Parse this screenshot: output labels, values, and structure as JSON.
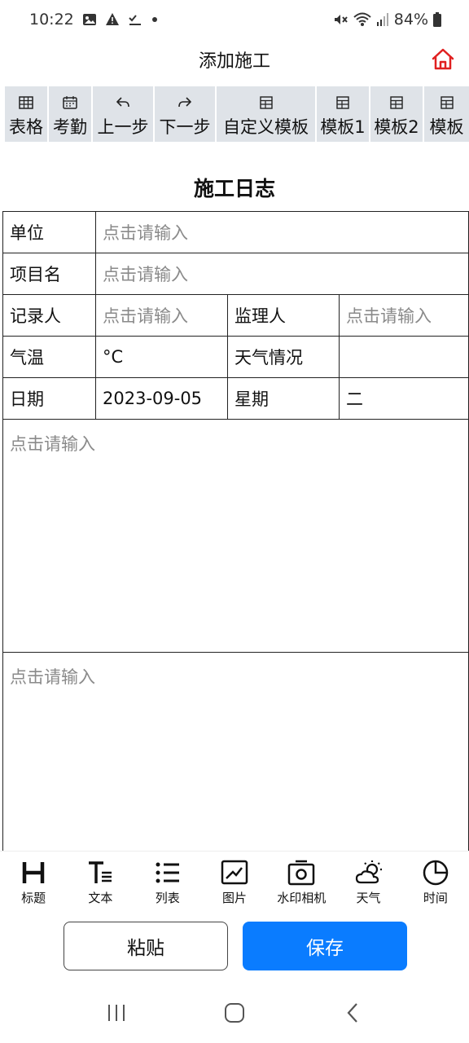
{
  "status_bar": {
    "time": "10:22",
    "battery": "84%",
    "left_icons": [
      "image-icon",
      "warning-icon",
      "checklist-icon",
      "dot-icon"
    ],
    "right_icons": [
      "mute-icon",
      "wifi-icon",
      "signal-icon",
      "battery-icon"
    ]
  },
  "header": {
    "title": "添加施工",
    "home_icon": "home-icon",
    "accent": "#e02020"
  },
  "toolbar": {
    "items": [
      {
        "label": "表格",
        "icon": "table-icon"
      },
      {
        "label": "考勤",
        "icon": "calendar-icon"
      },
      {
        "label": "上一步",
        "icon": "undo-icon"
      },
      {
        "label": "下一步",
        "icon": "redo-icon"
      },
      {
        "label": "自定义模板",
        "icon": "template-icon"
      },
      {
        "label": "模板1",
        "icon": "template-icon"
      },
      {
        "label": "模板2",
        "icon": "template-icon"
      },
      {
        "label": "模板",
        "icon": "template-icon"
      }
    ]
  },
  "document": {
    "title": "施工日志",
    "placeholder": "点击请输入",
    "rows": {
      "unit_label": "单位",
      "project_label": "项目名",
      "recorder_label": "记录人",
      "supervisor_label": "监理人",
      "temp_label": "气温",
      "temp_value": "°C",
      "weather_label": "天气情况",
      "date_label": "日期",
      "date_value": "2023-09-05",
      "weekday_label": "星期",
      "weekday_value": "二"
    }
  },
  "bottom_tools": {
    "items": [
      {
        "label": "标题",
        "icon": "heading-icon"
      },
      {
        "label": "文本",
        "icon": "text-icon"
      },
      {
        "label": "列表",
        "icon": "list-icon"
      },
      {
        "label": "图片",
        "icon": "picture-icon"
      },
      {
        "label": "水印相机",
        "icon": "camera-icon"
      },
      {
        "label": "天气",
        "icon": "weather-icon"
      },
      {
        "label": "时间",
        "icon": "clock-icon"
      }
    ]
  },
  "actions": {
    "paste_label": "粘贴",
    "save_label": "保存",
    "save_color": "#0a7cff"
  },
  "nav_bar": {
    "icons": [
      "recent-apps-icon",
      "home-nav-icon",
      "back-icon"
    ]
  }
}
